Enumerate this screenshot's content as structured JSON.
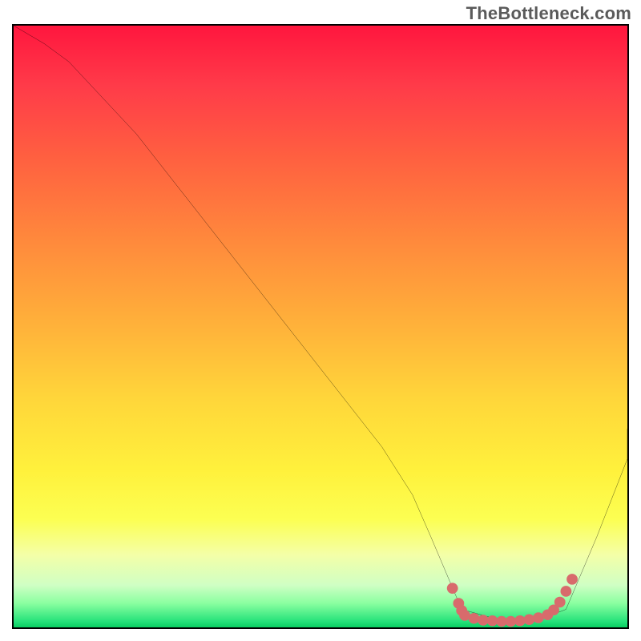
{
  "watermark": "TheBottleneck.com",
  "chart_data": {
    "type": "line",
    "title": "",
    "xlabel": "",
    "ylabel": "",
    "xlim": [
      0,
      100
    ],
    "ylim": [
      0,
      100
    ],
    "grid": false,
    "series": [
      {
        "name": "bottleneck-curve",
        "color": "#000000",
        "x": [
          0,
          5,
          9,
          20,
          30,
          40,
          50,
          60,
          65,
          68,
          73,
          80,
          85,
          90,
          95,
          100,
          100
        ],
        "y": [
          100,
          97,
          94,
          82,
          69,
          56,
          43,
          30,
          22,
          15,
          3,
          1,
          1,
          3,
          15,
          28,
          33
        ]
      },
      {
        "name": "optimal-range-marker",
        "color": "#d86b6c",
        "x": [
          71.5,
          72.5,
          73,
          73.5,
          75,
          76.5,
          78,
          79.5,
          81,
          82.5,
          84,
          85.5,
          87,
          88,
          89,
          90,
          91
        ],
        "y": [
          6.5,
          4,
          2.8,
          2,
          1.5,
          1.2,
          1.1,
          1,
          1,
          1.1,
          1.3,
          1.6,
          2.1,
          2.9,
          4.2,
          6,
          8
        ]
      }
    ],
    "gradient_stops": [
      {
        "offset": 0,
        "color": "#ff163e"
      },
      {
        "offset": 10,
        "color": "#ff3b49"
      },
      {
        "offset": 22,
        "color": "#ff6040"
      },
      {
        "offset": 36,
        "color": "#ff8a3c"
      },
      {
        "offset": 50,
        "color": "#ffb23a"
      },
      {
        "offset": 62,
        "color": "#ffd63a"
      },
      {
        "offset": 74,
        "color": "#fff13c"
      },
      {
        "offset": 82,
        "color": "#fcff52"
      },
      {
        "offset": 88,
        "color": "#f4ffa8"
      },
      {
        "offset": 93,
        "color": "#cfffc4"
      },
      {
        "offset": 96,
        "color": "#8affa0"
      },
      {
        "offset": 99,
        "color": "#26e27a"
      },
      {
        "offset": 100,
        "color": "#09cf62"
      }
    ]
  }
}
